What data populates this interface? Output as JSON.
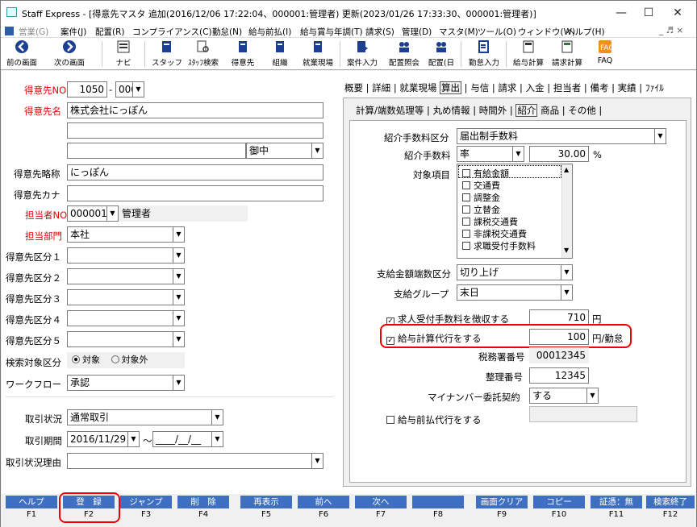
{
  "window": {
    "title": "Staff Express - [得意先マスタ 追加(2016/12/06 17:22:04、000001:管理者) 更新(2023/01/26 17:33:30、000001:管理者)]",
    "min": "—",
    "max": "☐",
    "close": "✕"
  },
  "menu": [
    "営業(G)",
    "案件(J)",
    "配置(R)",
    "コンプライアンス(C)",
    "勤怠(N)",
    "給与前払(I)",
    "給与賞与年調(T)",
    "請求(S)",
    "管理(D)",
    "マスタ(M)",
    "ツール(O)",
    "ウィンドウ(W)",
    "ヘルプ(H)"
  ],
  "menu_right": "_ ♬ ×",
  "toolbar": [
    "前の画面",
    "次の画面",
    "ナビ",
    "スタッフ",
    "ｽﾀｯﾌ検索",
    "得意先",
    "組織",
    "就業現場",
    "案件入力",
    "配置照会",
    "配置(日",
    "勤怠入力",
    "給与計算",
    "請求計算",
    "FAQ"
  ],
  "left": {
    "code_label": "得意先NO",
    "code": "1050",
    "sep": "-",
    "branch": "000",
    "name_label": "得意先名",
    "name": "株式会社にっぽん",
    "honorific": "御中",
    "short_label": "得意先略称",
    "short": "にっぽん",
    "kana_label": "得意先カナ",
    "kana": "",
    "staff_label": "担当者NO",
    "staff_no": "000001",
    "staff_name": "管理者",
    "dept_label": "担当部門",
    "dept": "本社",
    "class1": "得意先区分１",
    "class2": "得意先区分２",
    "class3": "得意先区分３",
    "class4": "得意先区分４",
    "class5": "得意先区分５",
    "search_label": "検索対象区分",
    "search_on": "対象",
    "search_off": "対象外",
    "workflow_label": "ワークフロー",
    "workflow": "承認",
    "trade_status_label": "取引状況",
    "trade_status": "通常取引",
    "trade_period_label": "取引期間",
    "trade_from": "2016/11/29",
    "tilde": "～",
    "trade_to": "____/__/__",
    "trade_reason_label": "取引状況理由"
  },
  "tabs": [
    "概要",
    "詳細",
    "就業現場",
    "算出",
    "与信",
    "請求",
    "入金",
    "担当者",
    "備考",
    "実績",
    "ﾌｧｲﾙ"
  ],
  "subtabs": [
    "計算/端数処理等",
    "丸め情報",
    "時間外",
    "紹介",
    "商品",
    "その他"
  ],
  "right": {
    "fee_kind_label": "紹介手数料区分",
    "fee_kind": "届出制手数料",
    "fee_label": "紹介手数料",
    "fee_unit": "率",
    "fee_value": "30.00",
    "fee_pct": "%",
    "items_label": "対象項目",
    "items": [
      "有給金額",
      "交通費",
      "調整金",
      "立替金",
      "課税交通費",
      "非課税交通費",
      "求職受付手数料"
    ],
    "round_label": "支給金額端数区分",
    "round": "切り上げ",
    "group_label": "支給グループ",
    "group": "末日",
    "collect_label": "求人受付手数料を徴収する",
    "collect_value": "710",
    "collect_unit": "円",
    "proxy_label": "給与計算代行をする",
    "proxy_value": "100",
    "proxy_unit": "円/勤怠",
    "tax_label": "税務署番号",
    "tax_no": "00012345",
    "reg_label": "整理番号",
    "reg_no": "12345",
    "mynumber_label": "マイナンバー委託契約",
    "mynumber": "する",
    "advance_label": "給与前払代行をする"
  },
  "fkeys": [
    {
      "label": "ヘルプ",
      "key": "F1"
    },
    {
      "label": "登　録",
      "key": "F2"
    },
    {
      "label": "ジャンプ",
      "key": "F3"
    },
    {
      "label": "削　除",
      "key": "F4"
    },
    {
      "label": "再表示",
      "key": "F5"
    },
    {
      "label": "前へ",
      "key": "F6"
    },
    {
      "label": "次へ",
      "key": "F7"
    },
    {
      "label": "",
      "key": "F8"
    },
    {
      "label": "画面クリア",
      "key": "F9"
    },
    {
      "label": "コピー",
      "key": "F10"
    },
    {
      "label": "証憑：無",
      "key": "F11"
    },
    {
      "label": "検索終了",
      "key": "F12"
    }
  ],
  "colors": {
    "accent": "#3f6fc1",
    "highlight": "#e00000",
    "required_label": "#e00000"
  }
}
